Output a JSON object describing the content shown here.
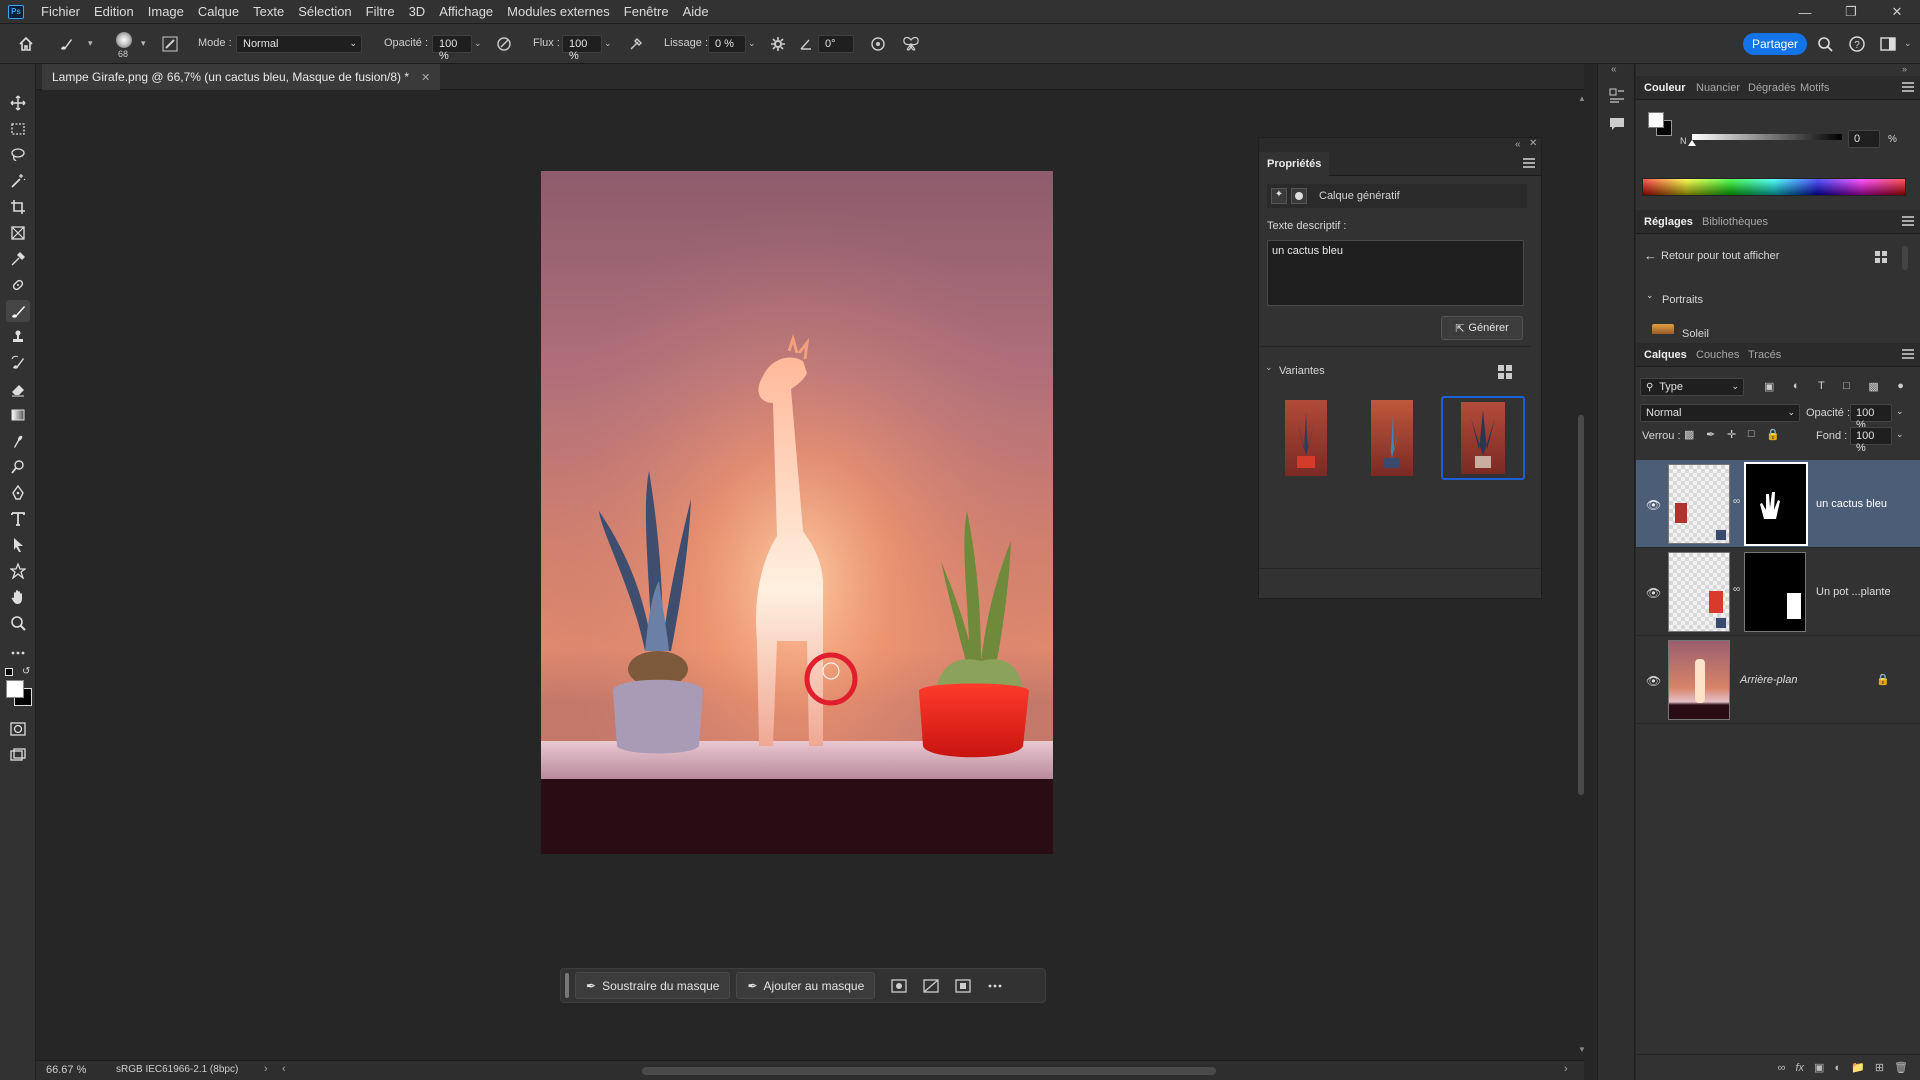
{
  "app": {
    "logo": "Ps",
    "menu": [
      "Fichier",
      "Edition",
      "Image",
      "Calque",
      "Texte",
      "Sélection",
      "Filtre",
      "3D",
      "Affichage",
      "Modules externes",
      "Fenêtre",
      "Aide"
    ]
  },
  "options": {
    "brush_size": "68",
    "mode_label": "Mode :",
    "mode_value": "Normal",
    "opacity_label": "Opacité :",
    "opacity_value": "100 %",
    "flow_label": "Flux :",
    "flow_value": "100 %",
    "smoothing_label": "Lissage :",
    "smoothing_value": "0 %",
    "angle_value": "0°",
    "share_label": "Partager"
  },
  "document": {
    "tab_title": "Lampe Girafe.png @ 66,7% (un cactus bleu, Masque de fusion/8) *",
    "zoom": "66.67 %",
    "color_profile": "sRGB IEC61966-2.1 (8bpc)"
  },
  "context_bar": {
    "subtract_label": "Soustraire du masque",
    "add_label": "Ajouter au masque"
  },
  "properties": {
    "title": "Propriétés",
    "layer_kind": "Calque génératif",
    "prompt_label": "Texte descriptif :",
    "prompt_value": "un cactus bleu",
    "generate_label": "Générer",
    "variants_label": "Variantes"
  },
  "color_panel": {
    "tabs": [
      "Couleur",
      "Nuancier",
      "Dégradés",
      "Motifs"
    ],
    "channel": "N",
    "value": "0",
    "unit": "%"
  },
  "adjustments_panel": {
    "tabs": [
      "Réglages",
      "Bibliothèques"
    ],
    "back_label": "Retour pour tout afficher",
    "section": "Portraits",
    "item": "Soleil"
  },
  "layers_panel": {
    "tabs": [
      "Calques",
      "Couches",
      "Tracés"
    ],
    "filter_value": "Type",
    "blend_mode": "Normal",
    "opacity_label": "Opacité :",
    "opacity_value": "100 %",
    "lock_label": "Verrou :",
    "fill_label": "Fond :",
    "fill_value": "100 %",
    "layers": [
      {
        "name": "un cactus bleu",
        "selected": true
      },
      {
        "name": "Un pot ...plante",
        "selected": false
      },
      {
        "name": "Arrière-plan",
        "selected": false
      }
    ]
  },
  "colors": {
    "accent": "#1473e6",
    "selected_layer": "#4c5d77",
    "panel_bg": "#323232"
  }
}
